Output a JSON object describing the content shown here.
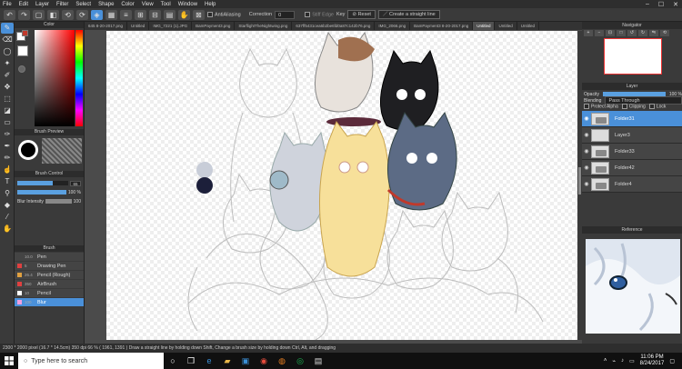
{
  "menu": [
    "File",
    "Edit",
    "Layer",
    "Filter",
    "Select",
    "Shape",
    "Color",
    "View",
    "Tool",
    "Window",
    "Help"
  ],
  "window_controls": [
    "–",
    "☐",
    "✕"
  ],
  "tool_options": {
    "antialiasing_label": "AntiAliasing",
    "correction_label": "Correction",
    "correction_value": "0",
    "stiff_edge_label": "Stiff Edge",
    "key_label": "Key",
    "reset_label": "Reset",
    "straight_line_label": "Create a straight line"
  },
  "tabs": [
    "645 8-20-2017.png",
    "Untitled",
    "IMG_7221 (1).JPG",
    "BamPayment3.png",
    "StarflightTheNightwing.png",
    "637ff5431cea6b2be6fd0a87c142b76.png",
    "IMG_2066.png",
    "BamPayment3 8-20-2017.png",
    "Untitled",
    "Untitled",
    "Untitled"
  ],
  "left_panel": {
    "color_title": "Color",
    "brush_preview_title": "Brush Preview",
    "brush_control_title": "Brush Control",
    "brush_size_value": "65",
    "brush_density_value": "100 %",
    "blur_intensity_label": "Blur Intensity",
    "blur_intensity_value": "100",
    "brush_title": "Brush",
    "brushes": [
      {
        "size": "10.0",
        "name": "Pen",
        "color": "#444444"
      },
      {
        "size": "5",
        "name": "Drawing Pen",
        "color": "#e04040"
      },
      {
        "size": "26.4",
        "name": "Pencil (Rough)",
        "color": "#e0a040"
      },
      {
        "size": "350",
        "name": "AirBrush",
        "color": "#e04040"
      },
      {
        "size": "10",
        "name": "Pencil",
        "color": "#ffffff"
      },
      {
        "size": "100",
        "name": "Blur",
        "color": "#f0a0e0"
      }
    ],
    "primary_color": "#ffffff",
    "secondary_color": "#c0392b"
  },
  "right_panel": {
    "navigator_title": "Navigator",
    "layer_title": "Layer",
    "opacity_label": "Opacity",
    "opacity_value": "100 %",
    "blending_label": "Blending",
    "blending_value": "Pass Through",
    "protect_alpha_label": "Protect Alpha",
    "clipping_label": "Clipping",
    "lock_label": "Lock",
    "layers": [
      {
        "name": "Folder31",
        "type": "folder",
        "selected": true
      },
      {
        "name": "Layer3",
        "type": "layer",
        "selected": false
      },
      {
        "name": "Folder33",
        "type": "folder",
        "selected": false
      },
      {
        "name": "Folder42",
        "type": "folder",
        "selected": false
      },
      {
        "name": "Folder4",
        "type": "folder",
        "selected": false
      }
    ],
    "reference_title": "Reference"
  },
  "status": {
    "text": "2300 * 2000 pixel  (16.7 * 14.5cm)  350 dpi   66 %   ( 1961, 1391 )   Draw a straight line by holding down Shift, Change a brush size by holding down Ctrl, Alt, and dragging"
  },
  "taskbar": {
    "search_placeholder": "Type here to search",
    "time": "11:06 PM",
    "date": "8/24/2017"
  }
}
